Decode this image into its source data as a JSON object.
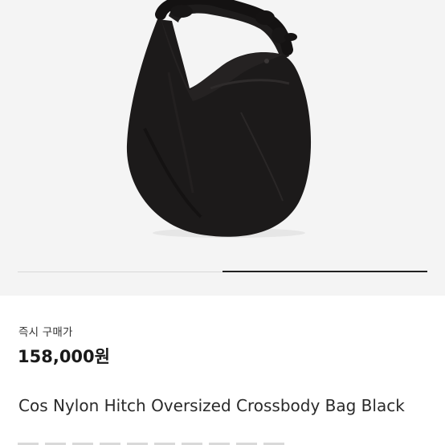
{
  "product": {
    "price_label": "즉시 구매가",
    "price": "158,000원",
    "title": "Cos Nylon Hitch Oversized Crossbody Bag Black"
  },
  "gallery": {
    "current_image": 2,
    "total_images": 2,
    "indicator_progress": 1.0,
    "image_alt": "Cos Nylon Hitch Oversized Crossbody Bag Black",
    "background_color": "#f4f4f4",
    "bag_color": "#1c1a1a"
  },
  "colors": {
    "text_primary": "#1a1a1a",
    "indicator_active": "#222222",
    "indicator_track": "#d8d8d8"
  }
}
